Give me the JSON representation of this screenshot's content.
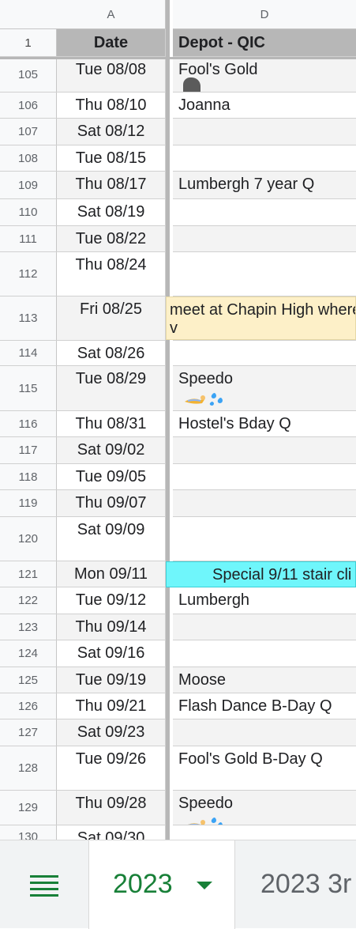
{
  "columns": {
    "a": "A",
    "d": "D"
  },
  "header_row": {
    "num": "1",
    "date": "Date",
    "depot": "Depot - QIC"
  },
  "rows": [
    {
      "num": "105",
      "date": "Tue 08/08",
      "depot": "Fool's Gold",
      "icon": "rock-icon"
    },
    {
      "num": "106",
      "date": "Thu 08/10",
      "depot": "Joanna"
    },
    {
      "num": "107",
      "date": "Sat 08/12",
      "depot": ""
    },
    {
      "num": "108",
      "date": "Tue 08/15",
      "depot": ""
    },
    {
      "num": "109",
      "date": "Thu 08/17",
      "depot": "Lumbergh 7 year Q"
    },
    {
      "num": "110",
      "date": "Sat 08/19",
      "depot": ""
    },
    {
      "num": "111",
      "date": "Tue 08/22",
      "depot": ""
    },
    {
      "num": "112",
      "date": "Thu 08/24",
      "depot": ""
    },
    {
      "num": "113",
      "date": "Fri 08/25",
      "depot": ""
    },
    {
      "num": "114",
      "date": "Sat 08/26",
      "depot": ""
    },
    {
      "num": "115",
      "date": "Tue 08/29",
      "depot": "Speedo",
      "icon": "swimmer-splash-icon"
    },
    {
      "num": "116",
      "date": "Thu 08/31",
      "depot": "Hostel's Bday Q"
    },
    {
      "num": "117",
      "date": "Sat 09/02",
      "depot": ""
    },
    {
      "num": "118",
      "date": "Tue 09/05",
      "depot": ""
    },
    {
      "num": "119",
      "date": "Thu 09/07",
      "depot": ""
    },
    {
      "num": "120",
      "date": "Sat 09/09",
      "depot": ""
    },
    {
      "num": "121",
      "date": "Mon 09/11",
      "depot": ""
    },
    {
      "num": "122",
      "date": "Tue 09/12",
      "depot": "Lumbergh"
    },
    {
      "num": "123",
      "date": "Thu 09/14",
      "depot": ""
    },
    {
      "num": "124",
      "date": "Sat 09/16",
      "depot": ""
    },
    {
      "num": "125",
      "date": "Tue 09/19",
      "depot": "Moose"
    },
    {
      "num": "126",
      "date": "Thu 09/21",
      "depot": "Flash Dance B-Day Q"
    },
    {
      "num": "127",
      "date": "Sat 09/23",
      "depot": ""
    },
    {
      "num": "128",
      "date": "Tue 09/26",
      "depot": "Fool's Gold B-Day Q"
    },
    {
      "num": "129",
      "date": "Thu 09/28",
      "depot": "Speedo",
      "icon": "swimmer-splash-icon"
    },
    {
      "num": "130",
      "date": "Sat 09/30",
      "depot": ""
    }
  ],
  "overflow_notes": {
    "row113_line1": "meet at Chapin High where",
    "row113_line2": "v",
    "row121": "Special 9/11 stair cli"
  },
  "colors": {
    "note_yellow": "#fdf0c8",
    "special_cyan": "#6ff6fb",
    "sheets_green": "#188038"
  },
  "tabs": {
    "active": "2023",
    "next": "2023 3r"
  }
}
